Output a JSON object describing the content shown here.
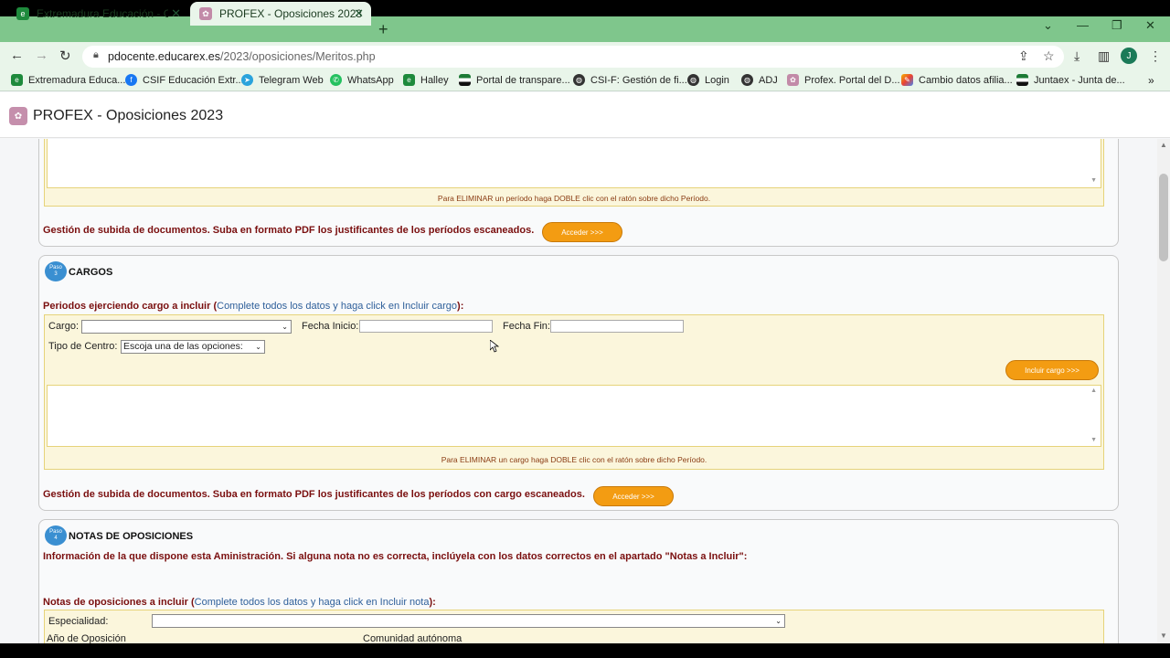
{
  "browser": {
    "tabs": [
      {
        "title": "Extremadura Educación - CONVO",
        "close": "✕"
      },
      {
        "title": "PROFEX - Oposiciones 2023",
        "close": "✕"
      }
    ],
    "new_tab": "+",
    "window_controls": {
      "menu": "⌄",
      "minimize": "—",
      "maximize": "❐",
      "close": "✕"
    },
    "url_domain": "pdocente.educarex.es",
    "url_path": "/2023/oposiciones/Meritos.php",
    "profile_initial": "J",
    "bookmarks": [
      "Extremadura Educa...",
      "CSIF Educación Extr...",
      "Telegram Web",
      "WhatsApp",
      "Halley",
      "Portal de transpare...",
      "CSI-F: Gestión de fi...",
      "Login",
      "ADJ",
      "Profex. Portal del D...",
      "Cambio datos afilia...",
      "Juntaex - Junta de..."
    ]
  },
  "app": {
    "title": "PROFEX - Oposiciones 2023"
  },
  "section_prev": {
    "hint": "Para ELIMINAR un período haga DOBLE clic con el ratón sobre dicho Período.",
    "upload_text": "Gestión de subida de documentos. Suba en formato PDF los justificantes de los períodos escaneados.",
    "button": "Acceder >>>"
  },
  "section_cargos": {
    "badge_top": "Paso",
    "badge_num": "3",
    "title": "CARGOS",
    "intro_bold": "Periodos ejerciendo cargo a incluir (",
    "intro_link": "Complete todos los datos y haga click en Incluir cargo",
    "intro_end": "):",
    "cargo_label": "Cargo:",
    "cargo_value": "",
    "fecha_inicio_label": "Fecha Inicio:",
    "fecha_fin_label": "Fecha Fin:",
    "tipo_centro_label": "Tipo de Centro:",
    "tipo_centro_value": "Escoja una de las opciones:",
    "include_button": "Incluir cargo >>>",
    "hint": "Para ELIMINAR un cargo haga DOBLE clic con el ratón sobre dicho Período.",
    "upload_text": "Gestión de subida de documentos. Suba en formato PDF los justificantes de los períodos con cargo escaneados.",
    "button": "Acceder >>>"
  },
  "section_notas": {
    "badge_top": "Paso",
    "badge_num": "4",
    "title": "NOTAS DE OPOSICIONES",
    "info": "Información de la que dispone esta Aministración. Si alguna nota no es correcta, inclúyela con los datos correctos en el apartado \"Notas a Incluir\":",
    "intro_bold": "Notas de oposiciones a incluir (",
    "intro_link": "Complete todos los datos y haga click en Incluir nota",
    "intro_end": "):",
    "especialidad_label": "Especialidad:",
    "anio_label": "Año de Oposición",
    "comunidad_label": "Comunidad autónoma"
  }
}
